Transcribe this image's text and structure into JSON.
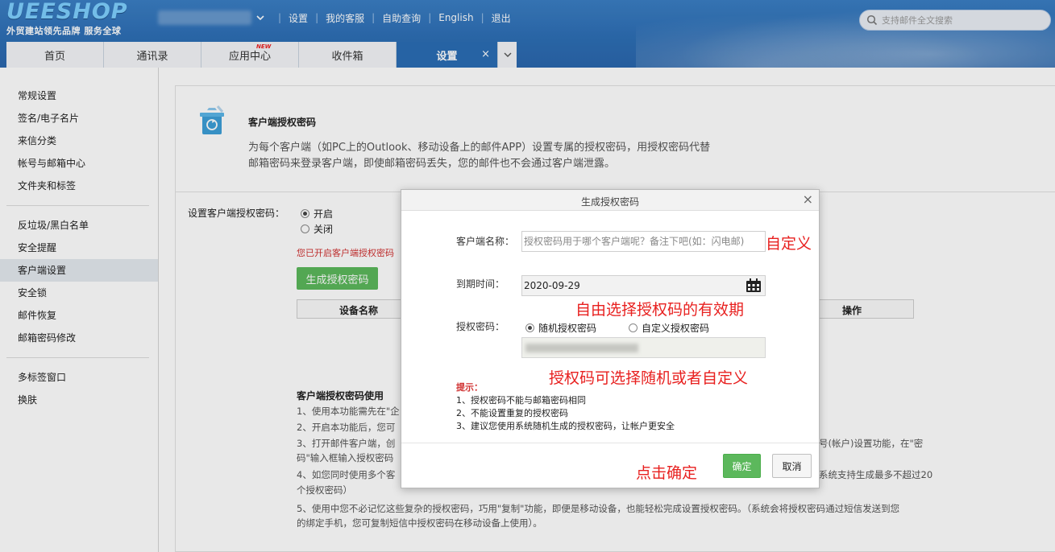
{
  "header": {
    "logo": "UEESHOP",
    "logo_tagline": "外贸建站领先品牌 服务全球",
    "nav": [
      "设置",
      "我的客服",
      "自助查询",
      "English",
      "退出"
    ],
    "search_placeholder": "支持邮件全文搜索",
    "tabs": [
      {
        "label": "首页"
      },
      {
        "label": "通讯录"
      },
      {
        "label": "应用中心",
        "badge": "NEW"
      },
      {
        "label": "收件箱"
      },
      {
        "label": "设置",
        "active": true
      }
    ],
    "tab_close": "×"
  },
  "sidebar": {
    "items": [
      {
        "label": "常规设置"
      },
      {
        "label": "签名/电子名片"
      },
      {
        "label": "来信分类"
      },
      {
        "label": "帐号与邮箱中心"
      },
      {
        "label": "文件夹和标签"
      },
      {
        "label": "反垃圾/黑白名单"
      },
      {
        "label": "安全提醒"
      },
      {
        "label": "客户端设置",
        "active": true
      },
      {
        "label": "安全锁"
      },
      {
        "label": "邮件恢复"
      },
      {
        "label": "邮箱密码修改"
      },
      {
        "label": "多标签窗口"
      },
      {
        "label": "换肤"
      }
    ]
  },
  "main": {
    "title": "客户端授权密码",
    "description": "为每个客户端（如PC上的Outlook、移动设备上的邮件APP）设置专属的授权密码，用授权密码代替邮箱密码来登录客户端，即使邮箱密码丢失，您的邮件也不会通过客户端泄露。",
    "setting_label": "设置客户端授权密码：",
    "radio_on": "开启",
    "radio_off": "关闭",
    "enabled_notice": "您已开启客户端授权密码",
    "generate_button": "生成授权密码",
    "table_headers": {
      "name": "设备名称",
      "action": "操作"
    },
    "help_title": "客户端授权密码使用",
    "help_lines": [
      "1、使用本功能需先在\"企",
      "2、开启本功能后，您可",
      "3、打开邮件客户端，创",
      "码\"输入框输入授权密码",
      "4、如您同时使用多个客",
      "个授权密码）",
      "5、使用中您不必记忆这些复杂的授权密码，巧用\"复制\"功能，即便是移动设备，也能轻松完成设置授权密码。（系统会将授权密码通过短信发送到您",
      "的绑定手机，您可复制短信中授权密码在移动设备上使用）。"
    ],
    "help_right_3": "号(帐户)设置功能，在\"密",
    "help_right_4": "系统支持生成最多不超过20"
  },
  "modal": {
    "title": "生成授权密码",
    "close": "×",
    "client_name_label": "客户端名称：",
    "client_name_placeholder": "授权密码用于哪个客户端呢？备注下吧(如：闪电邮)",
    "expiry_label": "到期时间：",
    "expiry_value": "2020-09-29",
    "password_label": "授权密码：",
    "option_random": "随机授权密码",
    "option_custom": "自定义授权密码",
    "tips_title": "提示：",
    "tips": [
      "1、授权密码不能与邮箱密码相同",
      "2、不能设置重复的授权密码",
      "3、建议您使用系统随机生成的授权密码，让帐户更安全"
    ],
    "ok_button": "确定",
    "cancel_button": "取消"
  },
  "annotations": {
    "custom": "自定义",
    "expiry": "自由选择授权码的有效期",
    "password": "授权码可选择随机或者自定义",
    "confirm": "点击确定"
  }
}
